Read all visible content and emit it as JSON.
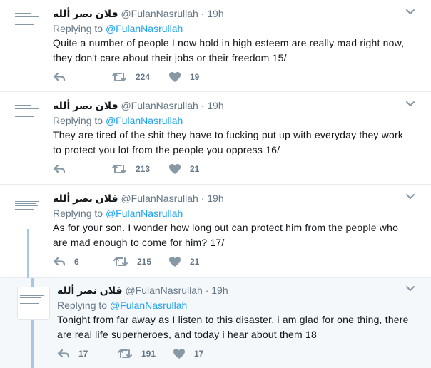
{
  "tweets": [
    {
      "display_name": "فلان نصر ألله",
      "handle": "@FulanNasrullah",
      "separator": "·",
      "time": "19h",
      "replying_label": "Replying to",
      "replying_to": "@FulanNasrullah",
      "text": "Quite a number of people I now hold in high esteem are really mad right now, they don't care about their jobs or their freedom 15/",
      "reply_count": "",
      "retweet_count": "224",
      "like_count": "19"
    },
    {
      "display_name": "فلان نصر ألله",
      "handle": "@FulanNasrullah",
      "separator": "·",
      "time": "19h",
      "replying_label": "Replying to",
      "replying_to": "@FulanNasrullah",
      "text": "They are tired of the shit they have to fucking put up with everyday they work to protect you lot from the people you oppress 16/",
      "reply_count": "",
      "retweet_count": "213",
      "like_count": "21"
    },
    {
      "display_name": "فلان نصر ألله",
      "handle": "@FulanNasrullah",
      "separator": "·",
      "time": "19h",
      "replying_label": "Replying to",
      "replying_to": "@FulanNasrullah",
      "text": "As for your son. I wonder how long out can protect him from the people who are mad enough to come for him? 17/",
      "reply_count": "6",
      "retweet_count": "215",
      "like_count": "21"
    },
    {
      "display_name": "فلان نصر ألله",
      "handle": "@FulanNasrullah",
      "separator": "·",
      "time": "19h",
      "replying_label": "Replying to",
      "replying_to": "@FulanNasrullah",
      "text": "Tonight from far away as I listen to this disaster, i am glad for one thing, there are real life superheroes, and today i hear about them 18",
      "reply_count": "17",
      "retweet_count": "191",
      "like_count": "17"
    }
  ],
  "colors": {
    "link": "#1da1f2",
    "muted": "#657786",
    "icon": "#8899a6",
    "thread_line": "#a7c7e8",
    "highlight_bg": "#f5f8fa"
  },
  "icons": {
    "reply": "reply-arrow-icon",
    "retweet": "retweet-icon",
    "like": "heart-icon",
    "menu": "chevron-down-icon"
  }
}
